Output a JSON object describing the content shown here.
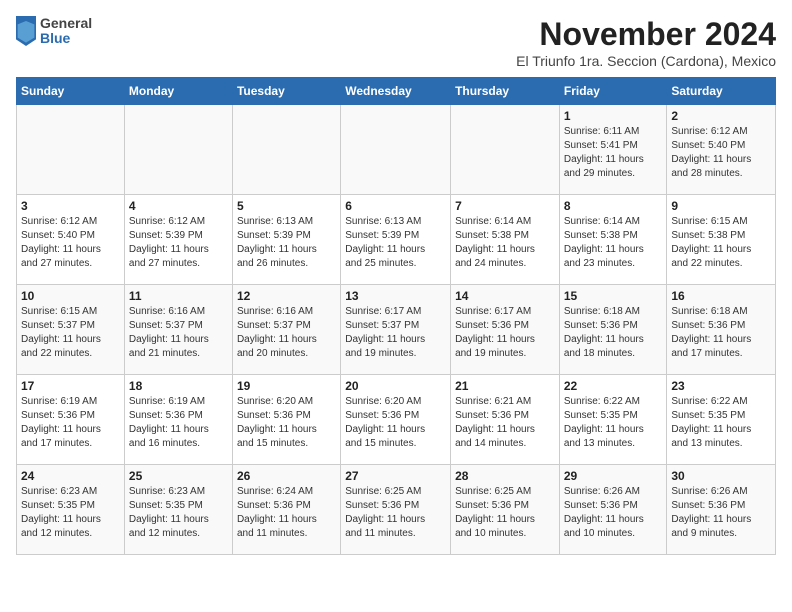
{
  "header": {
    "logo_general": "General",
    "logo_blue": "Blue",
    "month": "November 2024",
    "location": "El Triunfo 1ra. Seccion (Cardona), Mexico"
  },
  "weekdays": [
    "Sunday",
    "Monday",
    "Tuesday",
    "Wednesday",
    "Thursday",
    "Friday",
    "Saturday"
  ],
  "weeks": [
    [
      {
        "day": "",
        "info": ""
      },
      {
        "day": "",
        "info": ""
      },
      {
        "day": "",
        "info": ""
      },
      {
        "day": "",
        "info": ""
      },
      {
        "day": "",
        "info": ""
      },
      {
        "day": "1",
        "info": "Sunrise: 6:11 AM\nSunset: 5:41 PM\nDaylight: 11 hours\nand 29 minutes."
      },
      {
        "day": "2",
        "info": "Sunrise: 6:12 AM\nSunset: 5:40 PM\nDaylight: 11 hours\nand 28 minutes."
      }
    ],
    [
      {
        "day": "3",
        "info": "Sunrise: 6:12 AM\nSunset: 5:40 PM\nDaylight: 11 hours\nand 27 minutes."
      },
      {
        "day": "4",
        "info": "Sunrise: 6:12 AM\nSunset: 5:39 PM\nDaylight: 11 hours\nand 27 minutes."
      },
      {
        "day": "5",
        "info": "Sunrise: 6:13 AM\nSunset: 5:39 PM\nDaylight: 11 hours\nand 26 minutes."
      },
      {
        "day": "6",
        "info": "Sunrise: 6:13 AM\nSunset: 5:39 PM\nDaylight: 11 hours\nand 25 minutes."
      },
      {
        "day": "7",
        "info": "Sunrise: 6:14 AM\nSunset: 5:38 PM\nDaylight: 11 hours\nand 24 minutes."
      },
      {
        "day": "8",
        "info": "Sunrise: 6:14 AM\nSunset: 5:38 PM\nDaylight: 11 hours\nand 23 minutes."
      },
      {
        "day": "9",
        "info": "Sunrise: 6:15 AM\nSunset: 5:38 PM\nDaylight: 11 hours\nand 22 minutes."
      }
    ],
    [
      {
        "day": "10",
        "info": "Sunrise: 6:15 AM\nSunset: 5:37 PM\nDaylight: 11 hours\nand 22 minutes."
      },
      {
        "day": "11",
        "info": "Sunrise: 6:16 AM\nSunset: 5:37 PM\nDaylight: 11 hours\nand 21 minutes."
      },
      {
        "day": "12",
        "info": "Sunrise: 6:16 AM\nSunset: 5:37 PM\nDaylight: 11 hours\nand 20 minutes."
      },
      {
        "day": "13",
        "info": "Sunrise: 6:17 AM\nSunset: 5:37 PM\nDaylight: 11 hours\nand 19 minutes."
      },
      {
        "day": "14",
        "info": "Sunrise: 6:17 AM\nSunset: 5:36 PM\nDaylight: 11 hours\nand 19 minutes."
      },
      {
        "day": "15",
        "info": "Sunrise: 6:18 AM\nSunset: 5:36 PM\nDaylight: 11 hours\nand 18 minutes."
      },
      {
        "day": "16",
        "info": "Sunrise: 6:18 AM\nSunset: 5:36 PM\nDaylight: 11 hours\nand 17 minutes."
      }
    ],
    [
      {
        "day": "17",
        "info": "Sunrise: 6:19 AM\nSunset: 5:36 PM\nDaylight: 11 hours\nand 17 minutes."
      },
      {
        "day": "18",
        "info": "Sunrise: 6:19 AM\nSunset: 5:36 PM\nDaylight: 11 hours\nand 16 minutes."
      },
      {
        "day": "19",
        "info": "Sunrise: 6:20 AM\nSunset: 5:36 PM\nDaylight: 11 hours\nand 15 minutes."
      },
      {
        "day": "20",
        "info": "Sunrise: 6:20 AM\nSunset: 5:36 PM\nDaylight: 11 hours\nand 15 minutes."
      },
      {
        "day": "21",
        "info": "Sunrise: 6:21 AM\nSunset: 5:36 PM\nDaylight: 11 hours\nand 14 minutes."
      },
      {
        "day": "22",
        "info": "Sunrise: 6:22 AM\nSunset: 5:35 PM\nDaylight: 11 hours\nand 13 minutes."
      },
      {
        "day": "23",
        "info": "Sunrise: 6:22 AM\nSunset: 5:35 PM\nDaylight: 11 hours\nand 13 minutes."
      }
    ],
    [
      {
        "day": "24",
        "info": "Sunrise: 6:23 AM\nSunset: 5:35 PM\nDaylight: 11 hours\nand 12 minutes."
      },
      {
        "day": "25",
        "info": "Sunrise: 6:23 AM\nSunset: 5:35 PM\nDaylight: 11 hours\nand 12 minutes."
      },
      {
        "day": "26",
        "info": "Sunrise: 6:24 AM\nSunset: 5:36 PM\nDaylight: 11 hours\nand 11 minutes."
      },
      {
        "day": "27",
        "info": "Sunrise: 6:25 AM\nSunset: 5:36 PM\nDaylight: 11 hours\nand 11 minutes."
      },
      {
        "day": "28",
        "info": "Sunrise: 6:25 AM\nSunset: 5:36 PM\nDaylight: 11 hours\nand 10 minutes."
      },
      {
        "day": "29",
        "info": "Sunrise: 6:26 AM\nSunset: 5:36 PM\nDaylight: 11 hours\nand 10 minutes."
      },
      {
        "day": "30",
        "info": "Sunrise: 6:26 AM\nSunset: 5:36 PM\nDaylight: 11 hours\nand 9 minutes."
      }
    ]
  ]
}
